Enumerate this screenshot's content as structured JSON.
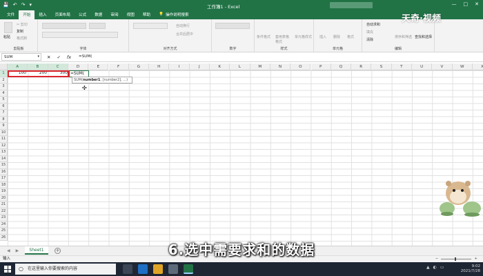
{
  "window": {
    "title": "工作簿1 - Excel",
    "minimize": "—",
    "maximize": "□",
    "close": "✕"
  },
  "quick_access": {
    "save": "💾",
    "undo": "↶",
    "redo": "↷",
    "more": "▾"
  },
  "tabs": [
    {
      "label": "文件",
      "active": false
    },
    {
      "label": "开始",
      "active": true
    },
    {
      "label": "插入",
      "active": false
    },
    {
      "label": "页面布局",
      "active": false
    },
    {
      "label": "公式",
      "active": false
    },
    {
      "label": "数据",
      "active": false
    },
    {
      "label": "审阅",
      "active": false
    },
    {
      "label": "视图",
      "active": false
    },
    {
      "label": "帮助",
      "active": false
    }
  ],
  "tell_me": "操作说明搜索",
  "ribbon": {
    "clipboard": {
      "label": "剪贴板",
      "paste": "粘贴",
      "cut": "✂ 剪切",
      "copy": "复制",
      "format_painter": "格式刷"
    },
    "font": {
      "label": "字体"
    },
    "alignment": {
      "label": "对齐方式",
      "wrap": "自动换行",
      "merge": "合并后居中"
    },
    "number": {
      "label": "数字",
      "format": "常规"
    },
    "styles": {
      "label": "样式",
      "conditional": "条件格式",
      "table": "套用表格格式",
      "cell": "单元格样式"
    },
    "cells": {
      "label": "单元格",
      "insert": "插入",
      "delete": "删除",
      "format": "格式"
    },
    "editing": {
      "label": "编辑",
      "autosum": "自动求和",
      "fill": "填充",
      "clear": "清除",
      "sort": "排序和筛选",
      "find": "查找和选择"
    }
  },
  "formula_bar": {
    "name_box": "SUM",
    "cancel": "✕",
    "enter": "✓",
    "fx": "fx",
    "content": "=SUM("
  },
  "columns": [
    "A",
    "B",
    "C",
    "D",
    "E",
    "F",
    "G",
    "H",
    "I",
    "J",
    "K",
    "L",
    "M",
    "N",
    "O",
    "P",
    "Q",
    "R",
    "S",
    "T",
    "U",
    "V",
    "W",
    "X"
  ],
  "rows": [
    "1",
    "2",
    "3",
    "4",
    "5",
    "6",
    "7",
    "8",
    "9",
    "10",
    "11",
    "12",
    "13",
    "14",
    "15",
    "16",
    "17",
    "18",
    "19",
    "20",
    "21",
    "22",
    "23",
    "24",
    "25",
    "26"
  ],
  "cells": {
    "A1": "100",
    "B1": "200",
    "C1": "300",
    "D1": "=SUM("
  },
  "tooltip": {
    "fn": "SUM(",
    "arg1": "number1",
    "rest": ", [number2], ...)"
  },
  "sheets": [
    {
      "name": "Sheet1",
      "active": true
    }
  ],
  "add_sheet": "+",
  "status": {
    "mode": "输入"
  },
  "subtitle": "6.选中需要求和的数据",
  "watermark": "天奇·视频",
  "taskbar": {
    "search_placeholder": "在这里输入你要搜索的内容",
    "time": "9:02",
    "date": "2021/7/28"
  },
  "colors": {
    "excel_green": "#217346",
    "selection_red": "#d9262c",
    "taskbar": "#1e2634"
  }
}
